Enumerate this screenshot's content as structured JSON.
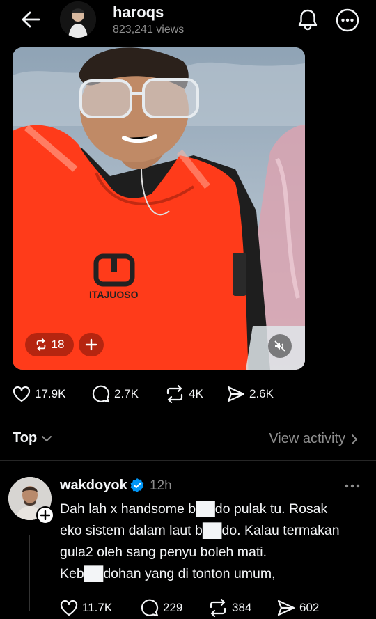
{
  "header": {
    "username": "haroqs",
    "views": "823,241 views"
  },
  "video": {
    "shirt_logo_text": "ITAJUOSO",
    "repost_count": "18"
  },
  "post_actions": {
    "likes": "17.9K",
    "comments": "2.7K",
    "reposts": "4K",
    "shares": "2.6K"
  },
  "sort": {
    "label": "Top",
    "view_activity": "View activity"
  },
  "comment": {
    "username": "wakdoyok",
    "time": "12h",
    "text": "Dah lah x handsome b██do pulak tu. Rosak\neko sistem dalam laut b██do. Kalau termakan\ngula2 oleh sang penyu boleh mati.\nKeb██dohan yang di tonton umum,",
    "likes": "11.7K",
    "replies": "229",
    "reposts": "384",
    "shares": "602"
  },
  "colors": {
    "background": "#000000",
    "text": "#f3f5f7",
    "muted": "#8e8e8e",
    "verified": "#0095f6",
    "vest": "#ff3b1a"
  }
}
